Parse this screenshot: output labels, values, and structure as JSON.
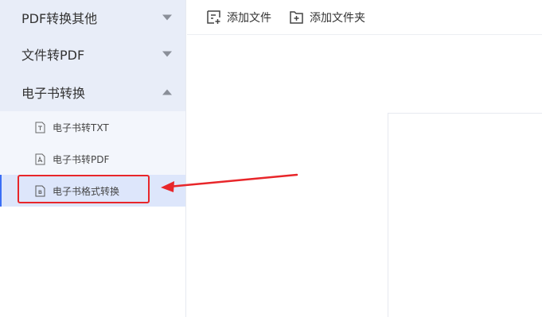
{
  "sidebar": {
    "groups": [
      {
        "label": "PDF转换其他",
        "expanded": false
      },
      {
        "label": "文件转PDF",
        "expanded": false
      },
      {
        "label": "电子书转换",
        "expanded": true,
        "items": [
          {
            "label": "电子书转TXT",
            "icon": "txt-file-icon"
          },
          {
            "label": "电子书转PDF",
            "icon": "pdf-file-icon"
          },
          {
            "label": "电子书格式转换",
            "icon": "ebook-file-icon",
            "active": true
          }
        ]
      }
    ]
  },
  "toolbar": {
    "add_file_label": "添加文件",
    "add_folder_label": "添加文件夹"
  },
  "colors": {
    "accent": "#3b6ef5",
    "highlight": "#e8262a",
    "group_bg": "#e8edf8",
    "sub_bg": "#f3f6fc"
  }
}
